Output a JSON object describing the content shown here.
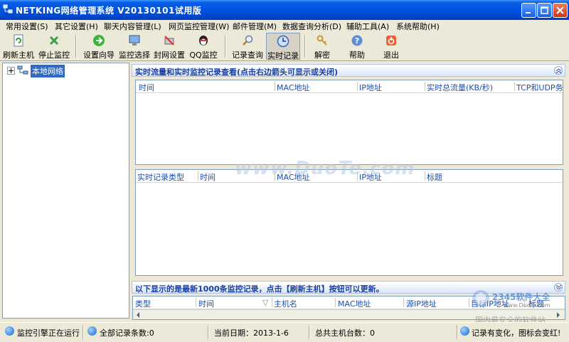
{
  "window": {
    "title": "NETKING网络管理系统 V20130101试用版"
  },
  "menu": [
    {
      "label": "常用设置(S)"
    },
    {
      "label": "其它设置(H)"
    },
    {
      "label": "聊天内容管理(L)"
    },
    {
      "label": "网页监控管理(W)"
    },
    {
      "label": "邮件管理(M)"
    },
    {
      "label": "数据查询分析(D)"
    },
    {
      "label": "辅助工具(A)"
    },
    {
      "label": "系统帮助(H)"
    }
  ],
  "toolbar": {
    "refresh_host": "刷新主机",
    "stop_monitor": "停止监控",
    "setup_wizard": "设置向导",
    "monitor_select": "监控选择",
    "block_settings": "封网设置",
    "qq_monitor": "QQ监控",
    "record_query": "记录查询",
    "realtime_record": "实时记录",
    "decrypt": "解密",
    "help": "帮助",
    "exit": "退出"
  },
  "tree": {
    "root_label": "本地网络"
  },
  "panel1": {
    "header": "实时流量和实时监控记录查看(点击右边箭头可显示或关闭)",
    "columns": [
      "时间",
      "MAC地址",
      "IP地址",
      "实时总流量(KB/秒)",
      "TCP和UDP务"
    ]
  },
  "panel2": {
    "columns": [
      "实时记录类型",
      "时间",
      "MAC地址",
      "IP地址",
      "标题"
    ]
  },
  "panel3": {
    "header": "以下显示的是最新1000条监控记录，点击【刷新主机】按钮可以更新。",
    "columns": [
      "类型",
      "时间",
      "主机名",
      "MAC地址",
      "源IP地址",
      "目标IP地址",
      "标题"
    ]
  },
  "status": {
    "engine": "监控引擎正在运行",
    "total_records": "全部记录条数:0",
    "current_date": "当前日期：2013-1-6",
    "total_hosts": "总共主机台数：0",
    "notice": "记录有变化，图标会变红!"
  },
  "watermark": {
    "center": "www.DuoTe.com",
    "corner_text": "2345软件大全",
    "corner_url": "www.DuoTe.com",
    "corner_sub": "国内最安全的软件站"
  },
  "colors": {
    "title_bar": "#0054e3",
    "panel_header_text": "#1a3fa0",
    "column_header_text": "#204ea8",
    "selection": "#316ac5"
  }
}
